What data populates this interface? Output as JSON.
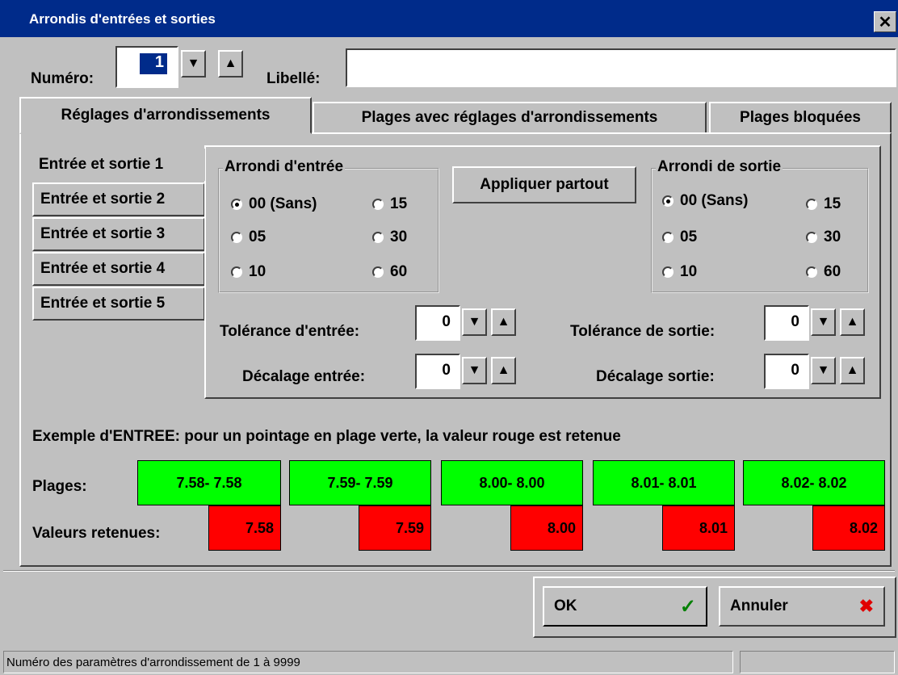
{
  "window": {
    "title": "Arrondis d'entrées et sorties"
  },
  "header": {
    "numero_label": "Numéro:",
    "numero_value": "1",
    "libelle_label": "Libellé:",
    "libelle_value": ""
  },
  "tabs": [
    {
      "label": "Réglages d'arrondissements",
      "active": true
    },
    {
      "label": "Plages avec réglages d'arrondissements"
    },
    {
      "label": "Plages bloquées"
    }
  ],
  "side_items": [
    "Entrée et sortie 1",
    "Entrée et sortie 2",
    "Entrée et sortie 3",
    "Entrée et sortie 4",
    "Entrée et sortie 5"
  ],
  "arrondi_entree": {
    "legend": "Arrondi d'entrée",
    "options": [
      "00 (Sans)",
      "15",
      "05",
      "30",
      "10",
      "60"
    ],
    "selected": "00 (Sans)"
  },
  "apply_button": "Appliquer partout",
  "arrondi_sortie": {
    "legend": "Arrondi de sortie",
    "options": [
      "00 (Sans)",
      "15",
      "05",
      "30",
      "10",
      "60"
    ],
    "selected": "00 (Sans)"
  },
  "tolerance_entree": {
    "label": "Tolérance d'entrée:",
    "value": "0"
  },
  "decalage_entree": {
    "label": "Décalage entrée:",
    "value": "0"
  },
  "tolerance_sortie": {
    "label": "Tolérance de sortie:",
    "value": "0"
  },
  "decalage_sortie": {
    "label": "Décalage sortie:",
    "value": "0"
  },
  "example": {
    "text": "Exemple d'ENTREE: pour un pointage en plage verte, la valeur rouge est retenue",
    "plages_label": "Plages:",
    "valeurs_label": "Valeurs retenues:",
    "plages": [
      "7.58- 7.58",
      "7.59- 7.59",
      "8.00- 8.00",
      "8.01- 8.01",
      "8.02- 8.02"
    ],
    "valeurs": [
      "7.58",
      "7.59",
      "8.00",
      "8.01",
      "8.02"
    ],
    "green_color": "#00ff00",
    "red_color": "#ff0000"
  },
  "buttons": {
    "ok": "OK",
    "cancel": "Annuler"
  },
  "status": {
    "text": "Numéro des paramètres d'arrondissement de 1 à 9999"
  },
  "icons": {
    "spin_down": "triangle-down",
    "spin_up": "triangle-up",
    "ok": "checkmark-icon",
    "cancel": "x-icon",
    "close": "close-icon"
  }
}
